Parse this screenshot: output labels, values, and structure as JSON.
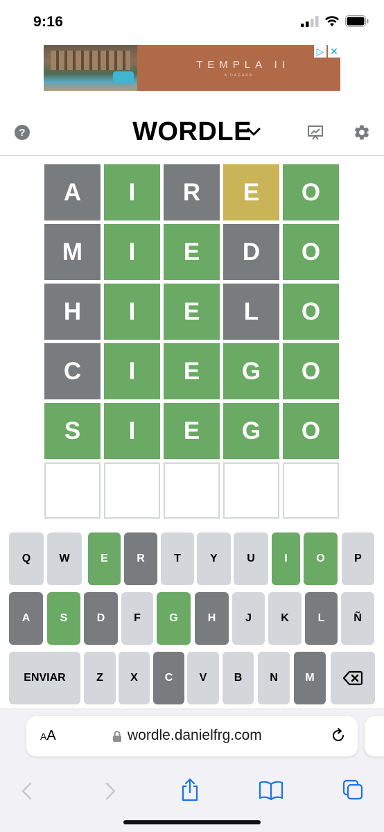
{
  "status": {
    "time": "9:16"
  },
  "ad": {
    "brand": "TEMPLA II",
    "subtitle": "A'DAGARA",
    "choice_icon": "adchoices-icon",
    "close_icon": "close-icon"
  },
  "header": {
    "help": "?",
    "title": "WORDLE",
    "icons": [
      "help-icon",
      "chevron-down-icon",
      "stats-icon",
      "gear-icon"
    ]
  },
  "board": {
    "rows": [
      {
        "letters": [
          "A",
          "I",
          "R",
          "E",
          "O"
        ],
        "states": [
          "gray",
          "green",
          "gray",
          "yellow",
          "green"
        ]
      },
      {
        "letters": [
          "M",
          "I",
          "E",
          "D",
          "O"
        ],
        "states": [
          "gray",
          "green",
          "green",
          "gray",
          "green"
        ]
      },
      {
        "letters": [
          "H",
          "I",
          "E",
          "L",
          "O"
        ],
        "states": [
          "gray",
          "green",
          "green",
          "gray",
          "green"
        ]
      },
      {
        "letters": [
          "C",
          "I",
          "E",
          "G",
          "O"
        ],
        "states": [
          "gray",
          "green",
          "green",
          "green",
          "green"
        ]
      },
      {
        "letters": [
          "S",
          "I",
          "E",
          "G",
          "O"
        ],
        "states": [
          "green",
          "green",
          "green",
          "green",
          "green"
        ]
      },
      {
        "letters": [
          "",
          "",
          "",
          "",
          ""
        ],
        "states": [
          "empty",
          "empty",
          "empty",
          "empty",
          "empty"
        ]
      }
    ],
    "colors": {
      "gray": "#787c7e",
      "green": "#6aaa64",
      "yellow": "#c9b458",
      "empty_border": "#d3d6da"
    }
  },
  "keyboard": {
    "rows": [
      [
        {
          "k": "Q",
          "s": ""
        },
        {
          "k": "W",
          "s": ""
        },
        {
          "k": "E",
          "s": "green"
        },
        {
          "k": "R",
          "s": "gray"
        },
        {
          "k": "T",
          "s": ""
        },
        {
          "k": "Y",
          "s": ""
        },
        {
          "k": "U",
          "s": ""
        },
        {
          "k": "I",
          "s": "green"
        },
        {
          "k": "O",
          "s": "green"
        },
        {
          "k": "P",
          "s": ""
        }
      ],
      [
        {
          "k": "A",
          "s": "gray"
        },
        {
          "k": "S",
          "s": "green"
        },
        {
          "k": "D",
          "s": "gray"
        },
        {
          "k": "F",
          "s": ""
        },
        {
          "k": "G",
          "s": "green"
        },
        {
          "k": "H",
          "s": "gray"
        },
        {
          "k": "J",
          "s": ""
        },
        {
          "k": "K",
          "s": ""
        },
        {
          "k": "L",
          "s": "gray"
        },
        {
          "k": "Ñ",
          "s": ""
        }
      ],
      [
        {
          "k": "ENVIAR",
          "s": ""
        },
        {
          "k": "Z",
          "s": ""
        },
        {
          "k": "X",
          "s": ""
        },
        {
          "k": "C",
          "s": "gray"
        },
        {
          "k": "V",
          "s": ""
        },
        {
          "k": "B",
          "s": ""
        },
        {
          "k": "N",
          "s": ""
        },
        {
          "k": "M",
          "s": "gray"
        },
        {
          "k": "",
          "s": "",
          "icon": "backspace-icon"
        }
      ]
    ]
  },
  "browser": {
    "aa_small": "A",
    "aa_big": "A",
    "url": "wordle.danielfrg.com",
    "icons": [
      "lock-icon",
      "reload-icon",
      "back-icon",
      "forward-icon",
      "share-icon",
      "bookmarks-icon",
      "tabs-icon"
    ]
  }
}
